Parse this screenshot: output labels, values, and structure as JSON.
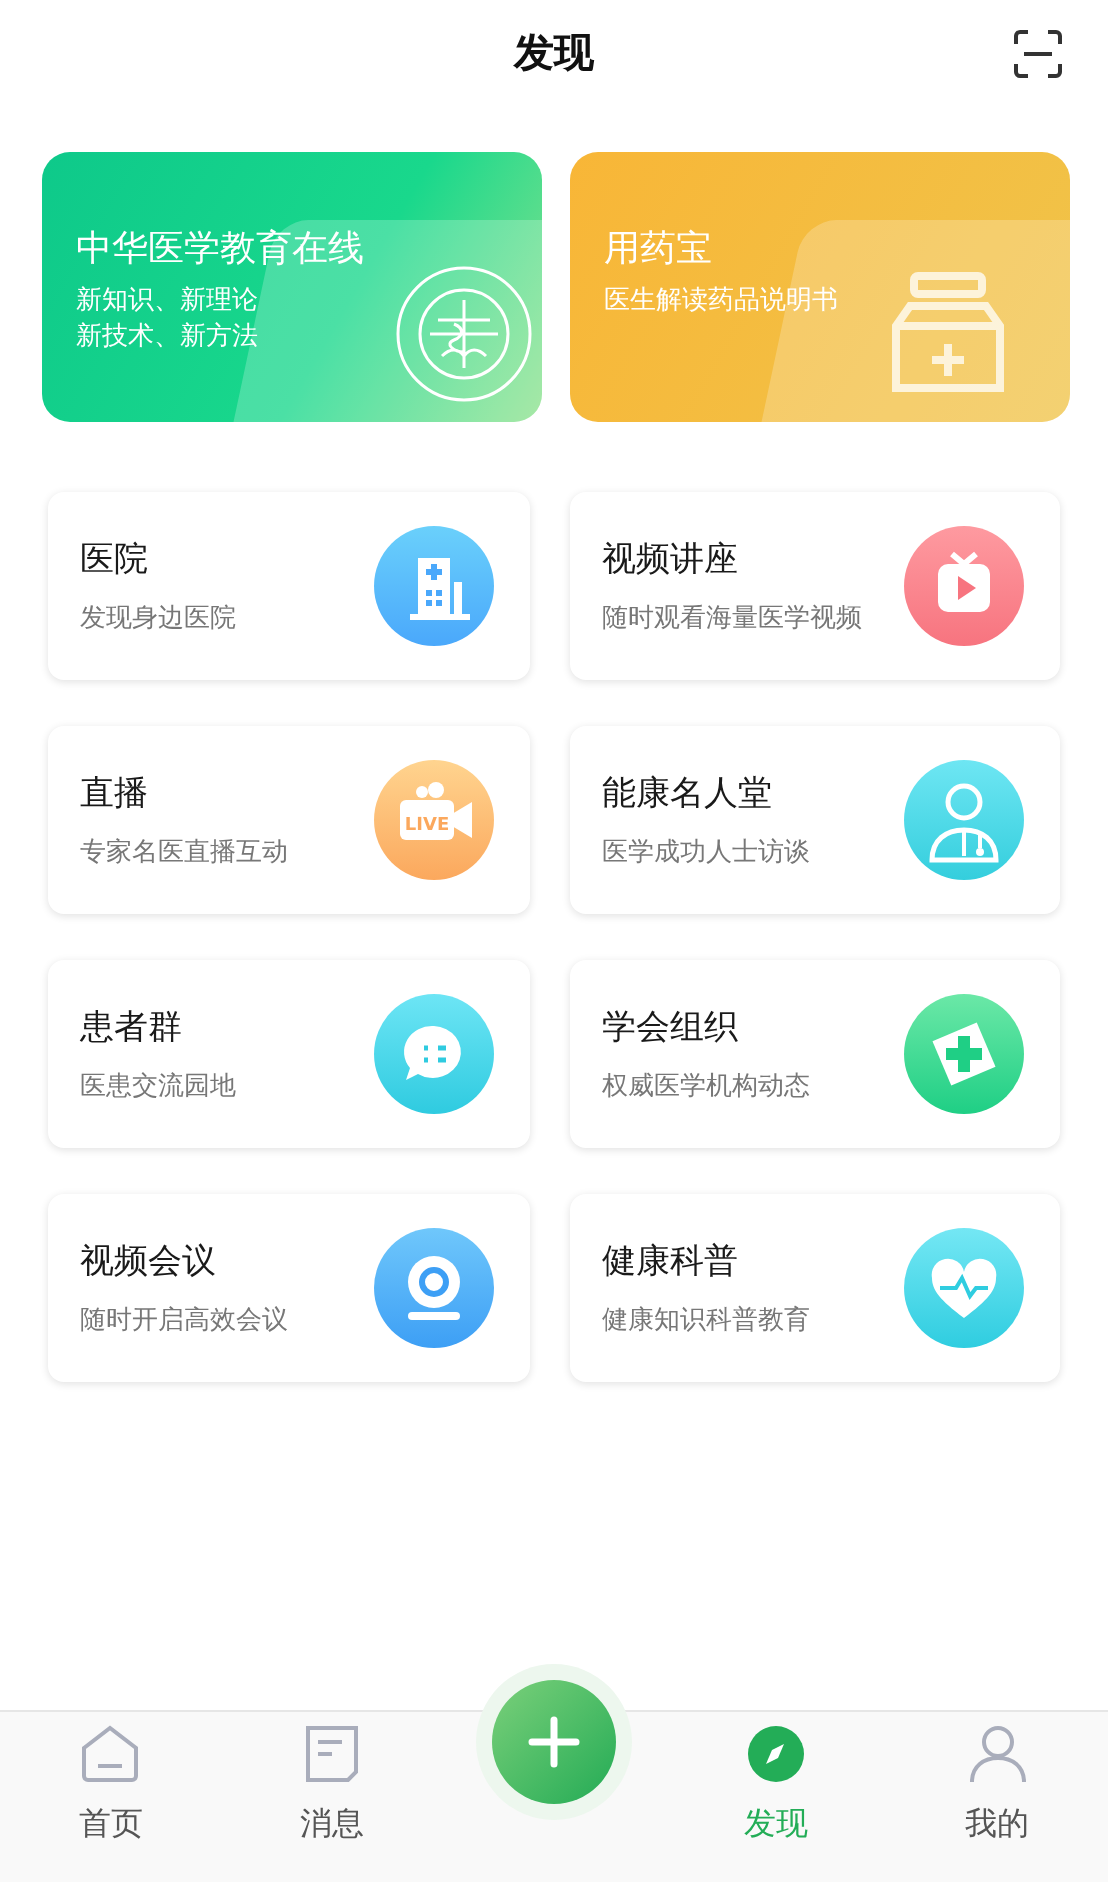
{
  "header": {
    "title": "发现"
  },
  "banners": [
    {
      "kind": "education",
      "title": "中华医学教育在线",
      "lines": [
        "新知识、新理论",
        "新技术、新方法"
      ]
    },
    {
      "kind": "medicine",
      "title": "用药宝",
      "lines": [
        "医生解读药品说明书"
      ]
    }
  ],
  "features": [
    {
      "kind": "hospital",
      "title": "医院",
      "subtitle": "发现身边医院"
    },
    {
      "kind": "tv",
      "title": "视频讲座",
      "subtitle": "随时观看海量医学视频"
    },
    {
      "kind": "live",
      "title": "直播",
      "subtitle": "专家名医直播互动",
      "icon_text": "LIVE"
    },
    {
      "kind": "doctor",
      "title": "能康名人堂",
      "subtitle": "医学成功人士访谈"
    },
    {
      "kind": "chat",
      "title": "患者群",
      "subtitle": "医患交流园地"
    },
    {
      "kind": "cross",
      "title": "学会组织",
      "subtitle": "权威医学机构动态"
    },
    {
      "kind": "webcam",
      "title": "视频会议",
      "subtitle": "随时开启高效会议"
    },
    {
      "kind": "heart",
      "title": "健康科普",
      "subtitle": "健康知识科普教育"
    }
  ],
  "tab_bar": [
    {
      "kind": "home",
      "label": "首页",
      "selected": false
    },
    {
      "kind": "message",
      "label": "消息",
      "selected": false
    },
    {
      "kind": "action"
    },
    {
      "kind": "discover",
      "label": "发现",
      "selected": true
    },
    {
      "kind": "person",
      "label": "我的",
      "selected": false
    }
  ]
}
